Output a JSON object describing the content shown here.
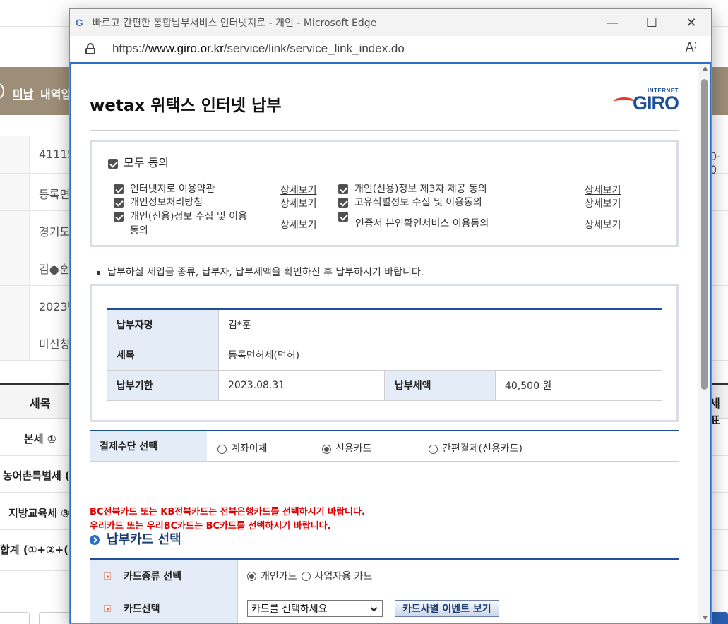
{
  "background": {
    "banner_link": "미납",
    "banner_text": "내역입",
    "rows": [
      "41115",
      "등록면",
      "경기도",
      "김●훈",
      "2023년",
      "미신청"
    ],
    "right_value": "0-0",
    "table_header": "세목",
    "table_header_right": "세표",
    "table_rows": [
      "본세 ①",
      "농어촌특별세 (",
      "지방교육세 ③",
      "합계 (①+②+("
    ]
  },
  "window": {
    "logo": "G",
    "title": "빠르고 간편한 통합납부서비스 인터넷지로 - 개인 - Microsoft Edge",
    "minimize": "—",
    "maximize": "☐",
    "close": "✕",
    "url_prefix": "https://",
    "url_host": "www.giro.or.kr",
    "url_path": "/service/link/service_link_index.do",
    "read_aloud": "A⁾"
  },
  "page": {
    "title": "wetax 위택스 인터넷 납부",
    "giro_logo_small": "INTERNET",
    "giro_logo_big": "GIRO",
    "agree_all": "모두 동의",
    "agreements": [
      {
        "label": "인터넷지로 이용약관",
        "link": "상세보기"
      },
      {
        "label": "개인정보처리방침",
        "link": "상세보기"
      },
      {
        "label": "개인(신용)정보 수집 및 이용",
        "label2": "동의",
        "link": "상세보기"
      },
      {
        "label": "개인(신용)정보 제3자 제공 동의",
        "link": "상세보기"
      },
      {
        "label": "고유식별정보 수집 및 이용동의",
        "link": "상세보기"
      },
      {
        "label": "인증서 본인확인서비스 이용동의",
        "link": "상세보기"
      }
    ],
    "notice": "납부하실 세입금 종류, 납부자, 납부세액을 확인하신 후 납부하시기 바랍니다.",
    "info": {
      "payer_label": "납부자명",
      "payer_value": "김*훈",
      "tax_label": "세목",
      "tax_value": "등록면허세(면허)",
      "due_label": "납부기한",
      "due_value": "2023.08.31",
      "amount_label": "납부세액",
      "amount_value": "40,500 원"
    },
    "payment": {
      "label": "결제수단 선택",
      "options": [
        "계좌이체",
        "신용카드",
        "간편결제(신용카드)"
      ],
      "selected": "신용카드"
    },
    "red_notice_1": "BC전북카드 또는 KB전북카드는 전북은행카드를 선택하시기 바랍니다.",
    "red_notice_2": "우리카드 또는 우리BC카드는 BC카드를 선택하시기 바랍니다.",
    "card_section_title": "납부카드 선택",
    "card": {
      "type_label": "카드종류 선택",
      "type_options": [
        "개인카드",
        "사업자용 카드"
      ],
      "type_selected": "개인카드",
      "select_label": "카드선택",
      "select_value": "카드를 선택하세요",
      "event_button": "카드사별 이벤트 보기"
    },
    "colors": {
      "accent_blue": "#1f4e9a",
      "header_bg": "#e4ecf7",
      "warning_red": "#e00000",
      "frame_blue": "#2a6fc9"
    }
  }
}
